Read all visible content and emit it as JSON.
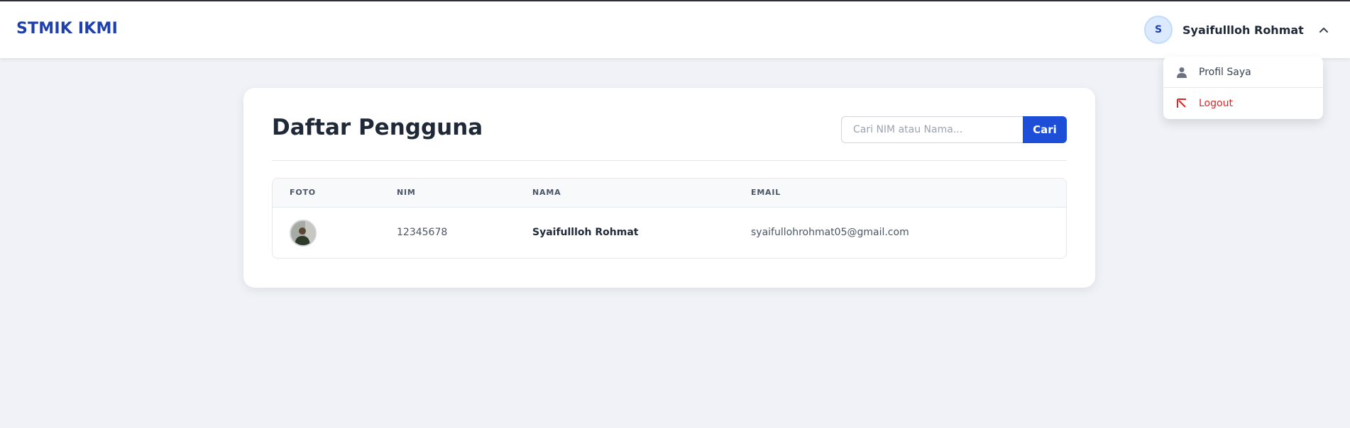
{
  "app": {
    "brand": "STMIK IKMI"
  },
  "user_menu": {
    "avatar_initial": "S",
    "name": "Syaifullloh Rohmat",
    "dropdown": {
      "items": [
        {
          "label": "Profil Saya",
          "icon": "user-icon"
        },
        {
          "label": "Logout",
          "icon": "logout-arrow-icon"
        }
      ]
    }
  },
  "page": {
    "title": "Daftar Pengguna",
    "search": {
      "placeholder": "Cari NIM atau Nama...",
      "value": "",
      "button_label": "Cari"
    }
  },
  "table": {
    "columns": [
      "FOTO",
      "NIM",
      "NAMA",
      "EMAIL"
    ],
    "rows": [
      {
        "photo": "user-photo",
        "nim": "12345678",
        "nama": "Syaifullloh Rohmat",
        "email": "syaifullohrohmat05@gmail.com"
      }
    ]
  },
  "colors": {
    "brand": "#1e40af",
    "primary_button": "#1d4ed8",
    "logout": "#dc2626",
    "background": "#f0f2f7"
  }
}
